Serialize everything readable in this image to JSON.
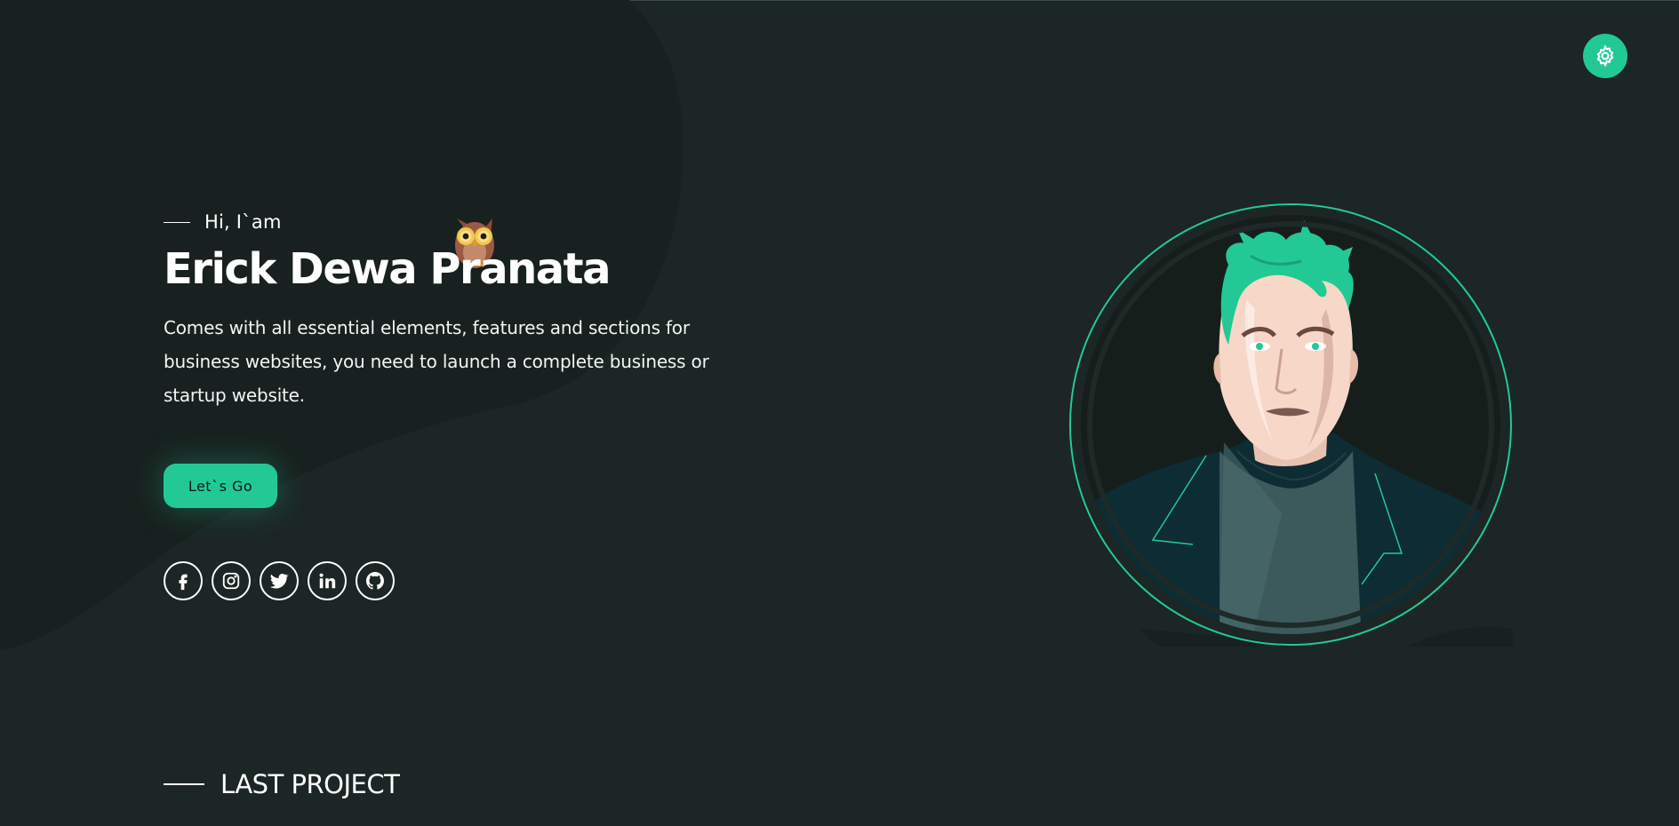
{
  "header": {
    "settings_icon": "gear-icon"
  },
  "hero": {
    "greeting": "Hi, I`am",
    "name": "Erick Dewa Pranata",
    "description": "Comes with all essential elements, features and sections for business websites, you need to launch a complete business or startup website.",
    "cta_label": "Let`s Go",
    "owl_icon": "owl-icon"
  },
  "social": [
    {
      "icon": "facebook-icon"
    },
    {
      "icon": "instagram-icon"
    },
    {
      "icon": "twitter-icon"
    },
    {
      "icon": "linkedin-icon"
    },
    {
      "icon": "github-icon"
    }
  ],
  "sections": {
    "last_project": "LAST PROJECT"
  },
  "colors": {
    "background": "#1c2624",
    "accent": "#22c995",
    "text": "#ffffff"
  }
}
